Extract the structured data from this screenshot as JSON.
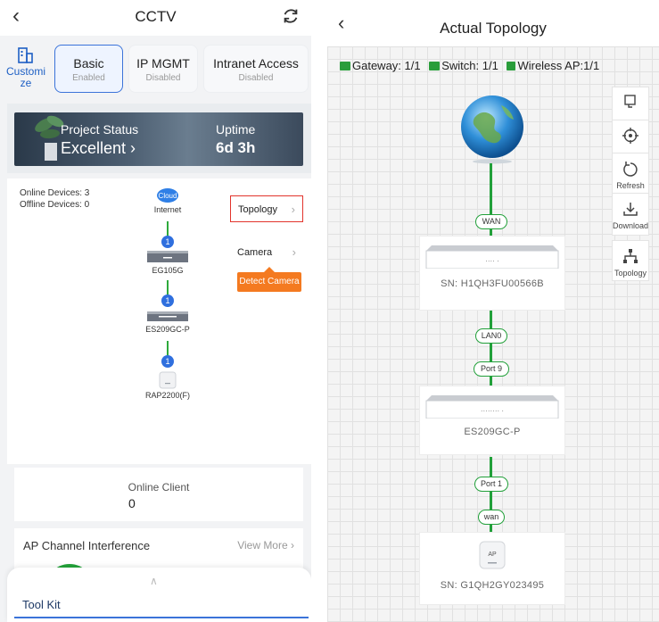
{
  "left": {
    "header": {
      "title": "CCTV"
    },
    "customize": {
      "label": "Customi ze"
    },
    "tabs": [
      {
        "title": "Basic",
        "status": "Enabled"
      },
      {
        "title": "IP MGMT",
        "status": "Disabled"
      },
      {
        "title": "Intranet Access",
        "status": "Disabled"
      }
    ],
    "project_status": {
      "label": "Project Status",
      "value": "Excellent",
      "uptime_label": "Uptime",
      "uptime_value": "6d 3h"
    },
    "devices": {
      "online": "Online Devices: 3",
      "offline": "Offline Devices: 0"
    },
    "chain": [
      {
        "name": "Internet",
        "icon_text": "Cloud",
        "badge": "1"
      },
      {
        "name": "EG105G",
        "badge": "1"
      },
      {
        "name": "ES209GC-P",
        "badge": "1"
      },
      {
        "name": "RAP2200(F)"
      }
    ],
    "side_buttons": {
      "topology": "Topology",
      "camera": "Camera",
      "detect": "Detect Camera"
    },
    "online_client": {
      "label": "Online Client",
      "value": "0"
    },
    "ap_channel": {
      "label": "AP Channel Interference",
      "view_more": "View More"
    },
    "toolkit": {
      "label": "Tool Kit"
    }
  },
  "right": {
    "header": {
      "title": "Actual Topology"
    },
    "summary": {
      "gateway": "Gateway: 1/1",
      "switch": "Switch: 1/1",
      "wireless_ap": "Wireless AP:1/1"
    },
    "toolbar": {
      "refresh": "Refresh",
      "download": "Download",
      "topology": "Topology"
    },
    "links": {
      "wan": "WAN",
      "lan0": "LAN0",
      "port9": "Port 9",
      "port1": "Port 1",
      "wan_lower": "wan"
    },
    "devices": {
      "gateway": {
        "sn": "SN:  H1QH3FU00566B",
        "panel_mark": "···· ·"
      },
      "switch": {
        "name": "ES209GC-P",
        "panel_mark": "········ ·"
      },
      "ap": {
        "sn": "SN:  G1QH2GY023495",
        "icon_text": "AP"
      }
    }
  },
  "colors": {
    "accent": "#3b73d9",
    "link_green": "#22a03a",
    "highlight_red": "#e2342c",
    "orange": "#f47a20"
  }
}
